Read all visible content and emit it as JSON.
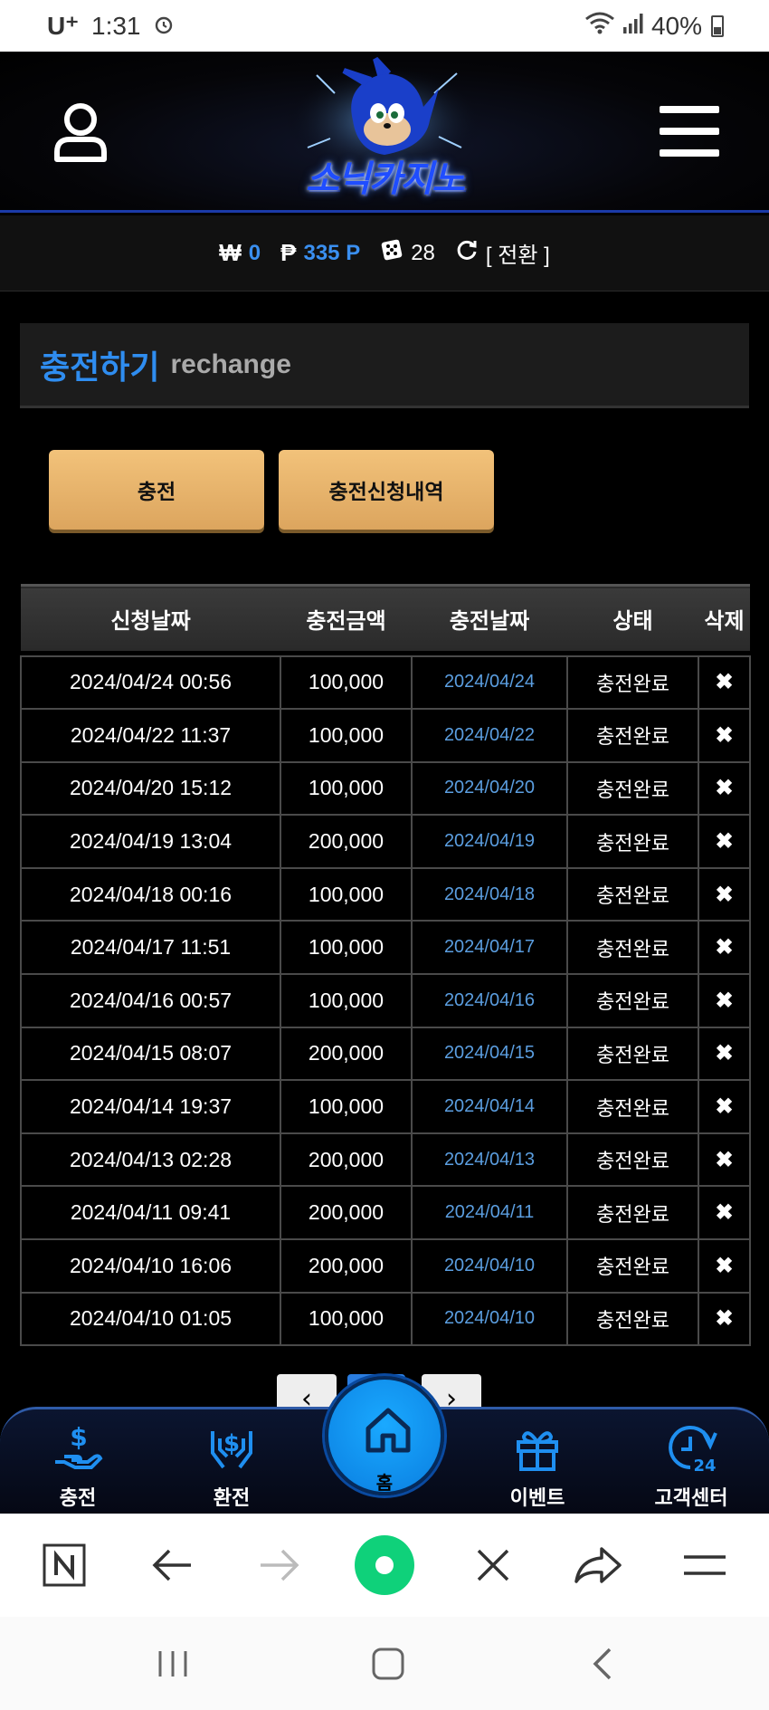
{
  "status_bar": {
    "carrier": "U⁺",
    "time": "1:31",
    "battery": "40%",
    "icons": [
      "alarm-icon",
      "wifi-icon",
      "signal-icon",
      "battery-icon"
    ]
  },
  "header": {
    "logo_text": "소닉카지노",
    "icons": [
      "user-icon",
      "menu-icon"
    ]
  },
  "balance": {
    "won_symbol": "₩",
    "won_value": "0",
    "point_symbol": "₱",
    "point_value": "335 P",
    "chip_value": "28",
    "convert_label": "[ 전환 ]"
  },
  "page_title": {
    "korean": "충전하기",
    "english": "rechange"
  },
  "buttons": {
    "charge": "충전",
    "history": "충전신청내역"
  },
  "table": {
    "headers": [
      "신청날짜",
      "충전금액",
      "충전날짜",
      "상태",
      "삭제"
    ],
    "rows": [
      [
        "2024/04/24 00:56",
        "100,000",
        "2024/04/24",
        "충전완료",
        "✖"
      ],
      [
        "2024/04/22 11:37",
        "100,000",
        "2024/04/22",
        "충전완료",
        "✖"
      ],
      [
        "2024/04/20 15:12",
        "100,000",
        "2024/04/20",
        "충전완료",
        "✖"
      ],
      [
        "2024/04/19 13:04",
        "200,000",
        "2024/04/19",
        "충전완료",
        "✖"
      ],
      [
        "2024/04/18 00:16",
        "100,000",
        "2024/04/18",
        "충전완료",
        "✖"
      ],
      [
        "2024/04/17 11:51",
        "100,000",
        "2024/04/17",
        "충전완료",
        "✖"
      ],
      [
        "2024/04/16 00:57",
        "100,000",
        "2024/04/16",
        "충전완료",
        "✖"
      ],
      [
        "2024/04/15 08:07",
        "200,000",
        "2024/04/15",
        "충전완료",
        "✖"
      ],
      [
        "2024/04/14 19:37",
        "100,000",
        "2024/04/14",
        "충전완료",
        "✖"
      ],
      [
        "2024/04/13 02:28",
        "200,000",
        "2024/04/13",
        "충전완료",
        "✖"
      ],
      [
        "2024/04/11 09:41",
        "200,000",
        "2024/04/11",
        "충전완료",
        "✖"
      ],
      [
        "2024/04/10 16:06",
        "200,000",
        "2024/04/10",
        "충전완료",
        "✖"
      ],
      [
        "2024/04/10 01:05",
        "100,000",
        "2024/04/10",
        "충전완료",
        "✖"
      ]
    ]
  },
  "pagination": {
    "prev": "‹",
    "next": "›"
  },
  "bottom_nav": {
    "items": [
      {
        "label": "충전",
        "icon": "deposit-icon"
      },
      {
        "label": "환전",
        "icon": "exchange-icon"
      },
      {
        "label": "홈",
        "icon": "home-icon"
      },
      {
        "label": "이벤트",
        "icon": "gift-icon"
      },
      {
        "label": "고객센터",
        "icon": "support-24h-icon"
      }
    ]
  },
  "browser_bar": {
    "icons": [
      "naver-icon",
      "back-icon",
      "forward-icon",
      "home-green-icon",
      "close-icon",
      "share-icon",
      "menu-icon"
    ]
  },
  "system_nav": {
    "icons": [
      "recents-icon",
      "home-icon",
      "back-icon"
    ]
  },
  "colors": {
    "accent_blue": "#2f8df0",
    "button_gold": "#e8b46a",
    "date_blue": "#5b9ee0"
  }
}
